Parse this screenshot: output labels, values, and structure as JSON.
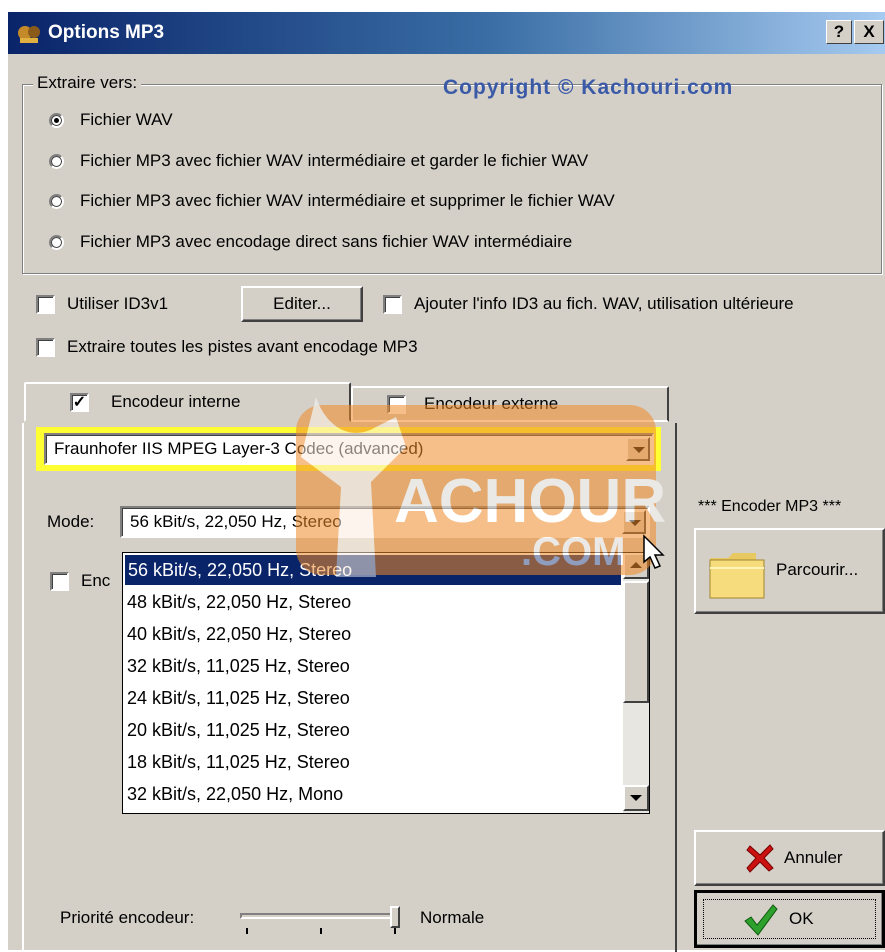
{
  "window": {
    "title": "Options MP3",
    "help_btn": "?",
    "close_btn": "X"
  },
  "extract": {
    "group_label": "Extraire vers:",
    "copyright": "Copyright © Kachouri.com",
    "options": [
      {
        "label": "Fichier WAV",
        "selected": true
      },
      {
        "label": "Fichier MP3 avec fichier WAV intermédiaire et garder le fichier WAV",
        "selected": false
      },
      {
        "label": "Fichier MP3 avec fichier WAV intermédiaire et supprimer le fichier WAV",
        "selected": false
      },
      {
        "label": "Fichier MP3 avec encodage direct sans fichier WAV intermédiaire",
        "selected": false
      }
    ]
  },
  "id3": {
    "use_id3v1_label": "Utiliser ID3v1",
    "edit_button": "Editer...",
    "add_id3_label": "Ajouter l'info ID3 au fich. WAV, utilisation ultérieure",
    "extract_all_label": "Extraire toutes les pistes avant encodage MP3"
  },
  "tabs": {
    "internal": "Encodeur interne",
    "external": "Encodeur externe"
  },
  "codec": {
    "selected": "Fraunhofer IIS MPEG Layer-3 Codec (advanced)"
  },
  "mode": {
    "label": "Mode:",
    "selected": "56 kBit/s, 22,050 Hz, Stereo",
    "options": [
      "56 kBit/s, 22,050 Hz, Stereo",
      "48 kBit/s, 22,050 Hz, Stereo",
      "40 kBit/s, 22,050 Hz, Stereo",
      "32 kBit/s, 11,025 Hz, Stereo",
      "24 kBit/s, 11,025 Hz, Stereo",
      "20 kBit/s, 11,025 Hz, Stereo",
      "18 kBit/s, 11,025 Hz, Stereo",
      "32 kBit/s, 22,050 Hz, Mono"
    ],
    "partial_checkbox_label": "Enc"
  },
  "watermark": {
    "line1": "ACHOURI",
    "line2": ".COM"
  },
  "right_panel": {
    "encoder_label": "*** Encoder MP3 ***",
    "browse_button": "Parcourir...",
    "cancel_button": "Annuler",
    "ok_button": "OK"
  },
  "priority": {
    "label": "Priorité encodeur:",
    "value_label": "Normale",
    "level": 1.0
  }
}
